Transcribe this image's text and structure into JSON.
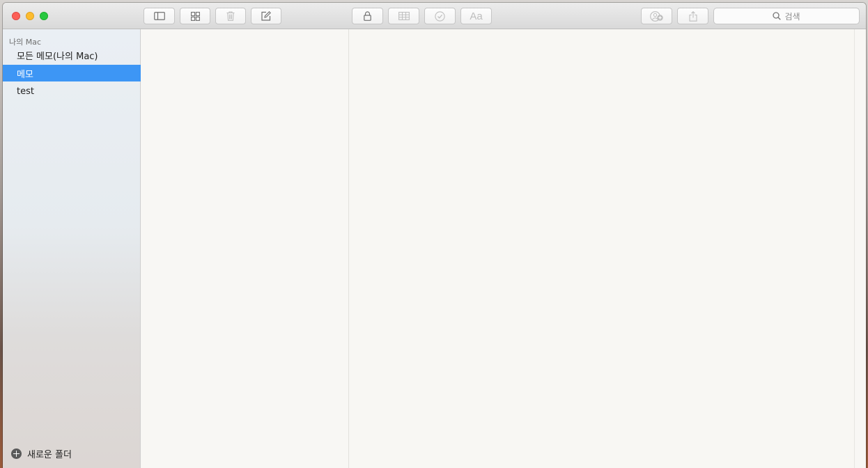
{
  "toolbar": {
    "search_placeholder": "검색",
    "buttons": [
      {
        "name": "sidebar-toggle-button",
        "icon": "sidebar-icon"
      },
      {
        "name": "gallery-view-button",
        "icon": "grid-icon"
      },
      {
        "name": "delete-button",
        "icon": "trash-icon"
      },
      {
        "name": "compose-button",
        "icon": "compose-icon"
      },
      {
        "name": "lock-button",
        "icon": "lock-icon"
      },
      {
        "name": "table-button",
        "icon": "table-icon"
      },
      {
        "name": "checklist-button",
        "icon": "checkmark-circle-icon"
      },
      {
        "name": "format-button",
        "icon": "text-format-icon",
        "label": "Aa"
      },
      {
        "name": "add-people-button",
        "icon": "add-people-icon"
      },
      {
        "name": "share-button",
        "icon": "share-icon"
      }
    ]
  },
  "sidebar": {
    "section_title": "나의 Mac",
    "items": [
      {
        "label": "모든 메모(나의 Mac)",
        "selected": false
      },
      {
        "label": "메모",
        "selected": true
      },
      {
        "label": "test",
        "selected": false
      }
    ],
    "new_folder_label": "새로운 폴더"
  },
  "colors": {
    "selection": "#3d96f5",
    "close": "#fc5f57",
    "minimize": "#fdbc2e",
    "maximize": "#28c840"
  }
}
